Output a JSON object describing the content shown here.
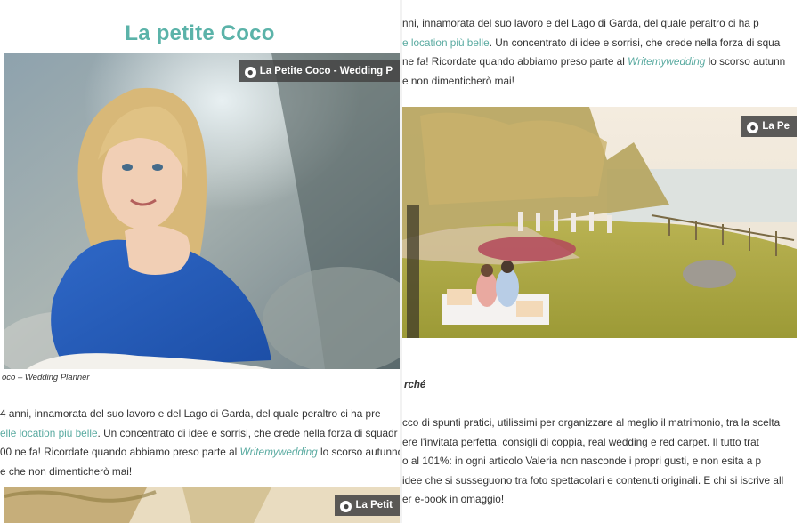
{
  "left": {
    "title": "La petite Coco",
    "pin_label": "La Petite Coco - Wedding P",
    "caption": "oco – Wedding Planner",
    "para": {
      "l1": "4 anni, innamorata del suo lavoro e del Lago di Garda, del quale peraltro ci ha pre",
      "l2_link": "elle location più belle",
      "l2_rest": ". Un concentrato di idee e sorrisi, che crede nella forza di squadr",
      "l3_pre": "00 ne fa! Ricordate quando abbiamo preso parte al ",
      "l3_link": "Writemywedding",
      "l3_post": " lo scorso autunno?",
      "l4": "e che non dimenticherò mai!"
    },
    "bottom_pin_label": "La Petit"
  },
  "right": {
    "para": {
      "l1": "nni, innamorata del suo lavoro e del Lago di Garda, del quale peraltro ci ha p",
      "l2_link": "e location più belle",
      "l2_rest": ". Un concentrato di idee e sorrisi, che crede nella forza di squa",
      "l3_pre": "ne fa! Ricordate quando abbiamo preso parte al ",
      "l3_link": "Writemywedding",
      "l3_post": " lo scorso autunn",
      "l4": "e non dimenticherò mai!"
    },
    "pin_label": "La Pe",
    "heading_fragment": "rché",
    "para2": [
      "cco di spunti pratici, utilissimi per organizzare al meglio il matrimonio, tra la scelta",
      "ere l'invitata perfetta, consigli di coppia, real wedding e red carpet. Il tutto trat",
      "o al 101%: in ogni articolo Valeria non nasconde i propri gusti, e non esita a p",
      "idee che si susseguono tra foto spettacolari e contenuti originali. E chi si iscrive all",
      "er e-book in omaggio!"
    ]
  },
  "colors": {
    "accent": "#5bb3a9",
    "text": "#333333",
    "pin_bg": "#464646"
  }
}
